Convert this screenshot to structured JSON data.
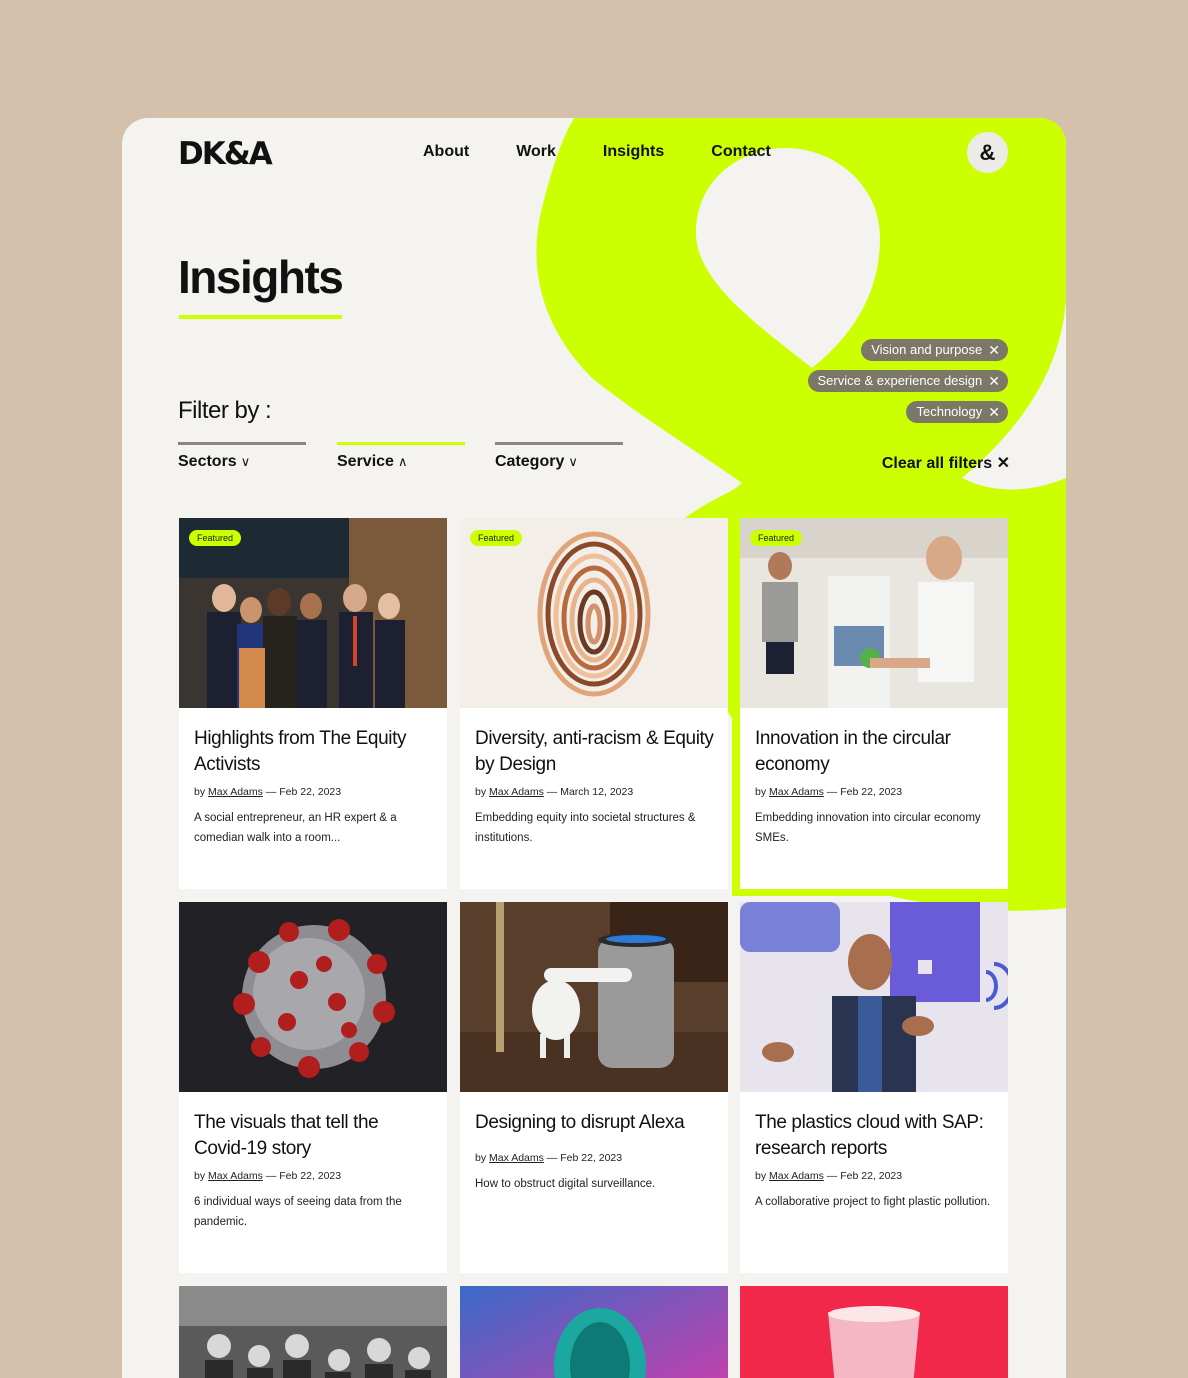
{
  "header": {
    "logo": "DK&A",
    "nav": [
      "About",
      "Work",
      "Insights",
      "Contact"
    ],
    "menu_icon": "ampersand-icon",
    "menu_glyph": "&"
  },
  "page": {
    "title": "Insights",
    "filter_label": "Filter by :",
    "filters": [
      {
        "label": "Sectors",
        "chevron": "chevron-down-icon",
        "glyph": "∨"
      },
      {
        "label": "Service",
        "chevron": "chevron-up-icon",
        "glyph": "∧"
      },
      {
        "label": "Category",
        "chevron": "chevron-down-icon",
        "glyph": "∨"
      }
    ],
    "clear_all": "Clear all filters",
    "close_glyph": "✕",
    "active_chips": [
      "Vision and purpose",
      "Service & experience design",
      "Technology"
    ]
  },
  "colors": {
    "accent": "#ccff00",
    "chip": "#7b7867",
    "background": "#d3c1ab",
    "page": "#f4f3ef"
  },
  "cards": [
    {
      "badge": "Featured",
      "title": "Highlights from The Equity Activists",
      "by": "by",
      "author": "Max Adams",
      "date": "— Feb 22, 2023",
      "desc": "A social entrepreneur, an HR expert & a comedian walk into a room..."
    },
    {
      "badge": "Featured",
      "title": "Diversity, anti-racism & Equity by Design",
      "by": "by",
      "author": "Max Adams",
      "date": "— March 12, 2023",
      "desc": "Embedding equity into societal structures & institutions."
    },
    {
      "badge": "Featured",
      "title": "Innovation in the circular economy",
      "by": "by",
      "author": "Max Adams",
      "date": "— Feb 22, 2023",
      "desc": "Embedding innovation into circular economy SMEs."
    },
    {
      "badge": "",
      "title": "The visuals that tell the Covid-19 story",
      "by": "by",
      "author": "Max Adams",
      "date": "— Feb 22, 2023",
      "desc": "6 individual ways of seeing data from the pandemic."
    },
    {
      "badge": "",
      "title": "Designing to disrupt Alexa",
      "by": "by",
      "author": "Max Adams",
      "date": "— Feb 22, 2023",
      "desc": "How to obstruct digital surveillance."
    },
    {
      "badge": "",
      "title": "The plastics cloud with SAP: research reports",
      "by": "by",
      "author": "Max Adams",
      "date": "— Feb 22, 2023",
      "desc": "A collaborative project to fight plastic pollution."
    }
  ]
}
